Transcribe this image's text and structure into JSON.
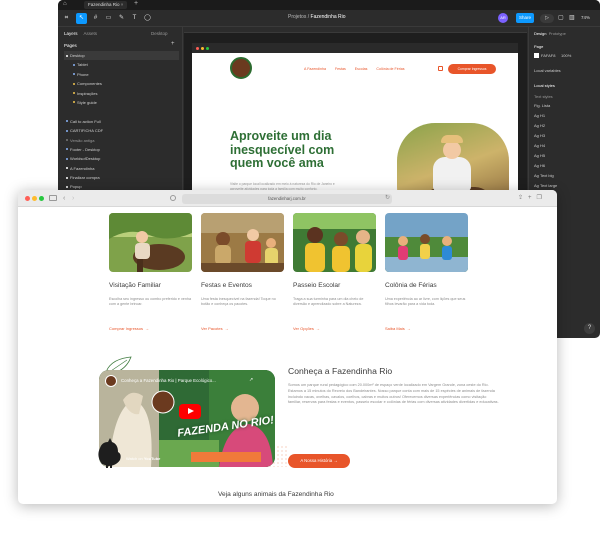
{
  "figma": {
    "tab_title": "Fazendinha Rio",
    "breadcrumb_project": "Projetos",
    "breadcrumb_sep": "/",
    "breadcrumb_file": "Fazendinha Rio",
    "share_label": "Share",
    "zoom": "74%",
    "avatar_initials": "AR",
    "tools": [
      "⌗",
      "↖",
      "#",
      "▭",
      "✎",
      "T",
      "◯"
    ],
    "left_tabs": {
      "layers": "Layers",
      "assets": "Assets",
      "desktop": "Desktop"
    },
    "pages_title": "Pages",
    "pages": [
      {
        "label": "Desktop",
        "selected": true
      },
      {
        "label": "Tablet",
        "sub": true
      },
      {
        "label": "Phone",
        "sub": true
      },
      {
        "label": "Componentes",
        "sub": true
      },
      {
        "label": "Inspirações",
        "sub": true
      },
      {
        "label": "Style guide",
        "sub": true
      },
      {
        "label": ""
      },
      {
        "label": "Call to action Full"
      },
      {
        "label": "CARTIFICHA CDF"
      },
      {
        "label": "Versão antiga"
      },
      {
        "label": "Footer - Desktop"
      },
      {
        "label": "WorldsofDesktop"
      },
      {
        "label": "A Fazendinha"
      },
      {
        "label": "Finalizar compra"
      },
      {
        "label": "Popup"
      }
    ],
    "right": {
      "tabs_design": "Design",
      "tabs_proto": "Prototype",
      "page_label": "Page",
      "color_hex": "FAFAF8",
      "color_pct": "100%",
      "local_variables": "Local variables",
      "local_styles": "Local styles",
      "text_styles": "Text styles",
      "font_size_label": "Fig. Lista",
      "style_items": [
        "H1",
        "H2",
        "H3",
        "H4",
        "H5",
        "H6",
        "Text big",
        "Text large"
      ]
    },
    "canvas_site": {
      "nav": [
        "A Fazendinha",
        "Festas",
        "Escolas",
        "Colônia de Férias"
      ],
      "cta": "Comprar Ingressos",
      "hero_title": "Aproveite um dia inesquecível com quem você ama",
      "hero_sub": "Visite o parque local localizado em meio à natureza do Rio de Janeiro e aproveite atividades para toda a família com muito conforto."
    }
  },
  "browser": {
    "url": "fazendinharj.com.br",
    "nav_back": "‹",
    "nav_forward": "›",
    "cards": [
      {
        "title": "Visitação Familiar",
        "desc": "Escolha seu ingresso ou combo preferido e venha com a gente brincar.",
        "link": "Comprar Ingressos"
      },
      {
        "title": "Festas e Eventos",
        "desc": "Uma festa inesquecível na fazenda! Toque no botão e conheça os pacotes.",
        "link": "Ver Pacotes"
      },
      {
        "title": "Passeio Escolar",
        "desc": "Traga a sua turminha para um dia cheio de diversão e aprendizado sobre a Natureza.",
        "link": "Ver Opções"
      },
      {
        "title": "Colônia de Férias",
        "desc": "Uma experiência ao ar livre, com lições que seus filhos levarão para a vida toda.",
        "link": "Saiba Mais"
      }
    ],
    "video": {
      "title": "Conheça a Fazendinha Rio | Parque Ecológico...",
      "overlay": "FAZENDA NO RIO!",
      "watch": "Watch on",
      "yt": "YouTube"
    },
    "about": {
      "title": "Conheça a Fazendinha Rio",
      "body": "Somos um parque rural pedagógico com 20.000m² de espaço verde localizado em Vargem Grande, zona oeste do Rio. Estamos a 15 minutos do Recreio dos Bandeirantes. Nosso parque conta com mais de 15 espécies de animais de fazenda incluindo vacas, ovelhas, cavalos, coelhos, cabras e muitos outros! Oferecemos diversas experiências como visitação familiar, reservas para festas e eventos, passeio escolar e colônias de férias com diversas atividades divertidas e educativas.",
      "button": "A Nossa História"
    },
    "animals_heading": "Veja alguns animais da Fazendinha Rio"
  },
  "colors": {
    "accent": "#e8552a",
    "brand_green": "#2e6f35",
    "figma_blue": "#0d99ff"
  }
}
